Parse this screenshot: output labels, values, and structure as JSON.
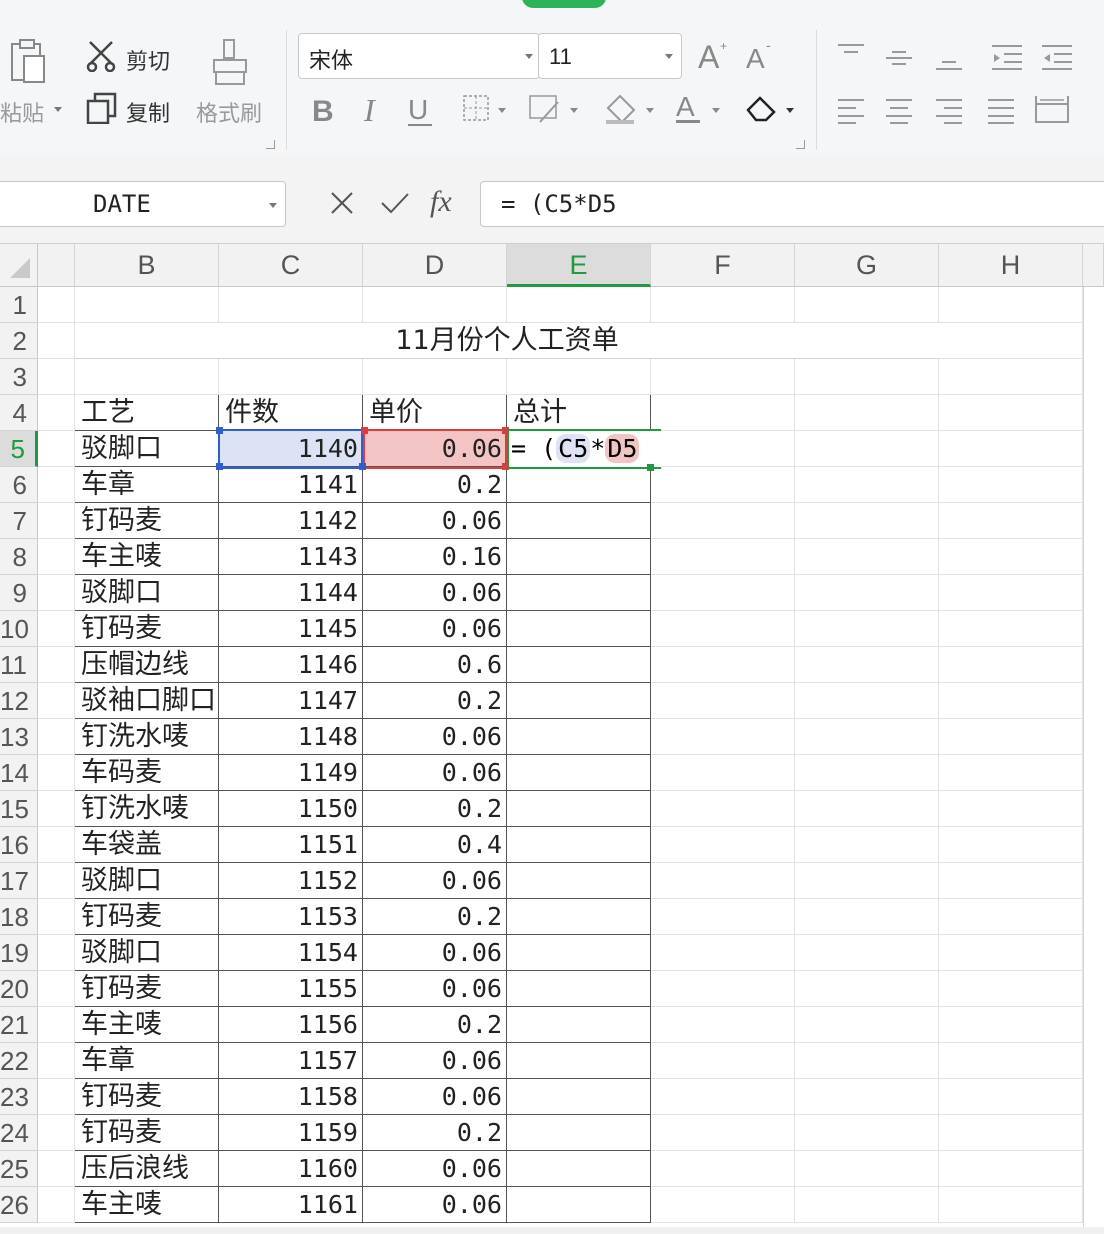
{
  "ribbon": {
    "cut_label": "剪切",
    "copy_label": "复制",
    "paste_label": "粘贴",
    "format_painter_label": "格式刷",
    "font_name": "宋体",
    "font_size": "11"
  },
  "formula_bar": {
    "name_box": "DATE",
    "formula": "= (C5*D5"
  },
  "grid": {
    "columns": [
      "B",
      "C",
      "D",
      "E",
      "F",
      "G",
      "H"
    ],
    "active_column": "E",
    "active_row": "5",
    "title": "11月份个人工资单",
    "headers": [
      "工艺",
      "件数",
      "单价",
      "总计"
    ],
    "rows": [
      {
        "row": "5",
        "craft": "驳脚口",
        "qty": "1140",
        "price": "0.06"
      },
      {
        "row": "6",
        "craft": "车章",
        "qty": "1141",
        "price": "0.2"
      },
      {
        "row": "7",
        "craft": "钉码麦",
        "qty": "1142",
        "price": "0.06"
      },
      {
        "row": "8",
        "craft": "车主唛",
        "qty": "1143",
        "price": "0.16"
      },
      {
        "row": "9",
        "craft": "驳脚口",
        "qty": "1144",
        "price": "0.06"
      },
      {
        "row": "10",
        "craft": "钉码麦",
        "qty": "1145",
        "price": "0.06"
      },
      {
        "row": "11",
        "craft": "压帽边线",
        "qty": "1146",
        "price": "0.6"
      },
      {
        "row": "12",
        "craft": "驳袖口脚口",
        "qty": "1147",
        "price": "0.2"
      },
      {
        "row": "13",
        "craft": "钉洗水唛",
        "qty": "1148",
        "price": "0.06"
      },
      {
        "row": "14",
        "craft": "车码麦",
        "qty": "1149",
        "price": "0.06"
      },
      {
        "row": "15",
        "craft": "钉洗水唛",
        "qty": "1150",
        "price": "0.2"
      },
      {
        "row": "16",
        "craft": "车袋盖",
        "qty": "1151",
        "price": "0.4"
      },
      {
        "row": "17",
        "craft": "驳脚口",
        "qty": "1152",
        "price": "0.06"
      },
      {
        "row": "18",
        "craft": "钉码麦",
        "qty": "1153",
        "price": "0.2"
      },
      {
        "row": "19",
        "craft": "驳脚口",
        "qty": "1154",
        "price": "0.06"
      },
      {
        "row": "20",
        "craft": "钉码麦",
        "qty": "1155",
        "price": "0.06"
      },
      {
        "row": "21",
        "craft": "车主唛",
        "qty": "1156",
        "price": "0.2"
      },
      {
        "row": "22",
        "craft": "车章",
        "qty": "1157",
        "price": "0.06"
      },
      {
        "row": "23",
        "craft": "钉码麦",
        "qty": "1158",
        "price": "0.06"
      },
      {
        "row": "24",
        "craft": "钉码麦",
        "qty": "1159",
        "price": "0.2"
      },
      {
        "row": "25",
        "craft": "压后浪线",
        "qty": "1160",
        "price": "0.06"
      },
      {
        "row": "26",
        "craft": "车主唛",
        "qty": "1161",
        "price": "0.06"
      }
    ],
    "edit_cell": {
      "prefix": "= (",
      "ref1": "C5",
      "op": "*",
      "ref2": "D5"
    },
    "row_numbers_top": [
      "1",
      "2",
      "3",
      "4"
    ]
  },
  "colors": {
    "ref1_border": "#2a5fd6",
    "ref1_fill": "#dde3f5",
    "ref2_border": "#e03a3a",
    "ref2_fill": "#f2c4c4",
    "active_cell_border": "#1f9a3d"
  }
}
